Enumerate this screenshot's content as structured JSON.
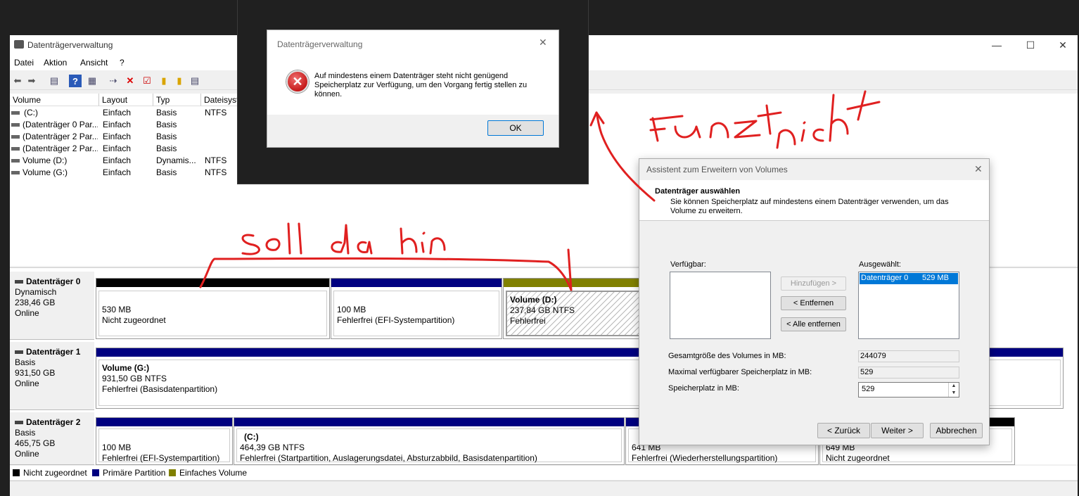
{
  "main_window": {
    "title": "Datenträgerverwaltung",
    "menu": [
      "Datei",
      "Aktion",
      "Ansicht",
      "?"
    ],
    "columns": [
      "Volume",
      "Layout",
      "Typ",
      "Dateisyst"
    ],
    "volumes": [
      {
        "name": "(C:)",
        "layout": "Einfach",
        "typ": "Basis",
        "fs": "NTFS"
      },
      {
        "name": "(Datenträger 0 Par...",
        "layout": "Einfach",
        "typ": "Basis",
        "fs": ""
      },
      {
        "name": "(Datenträger 2 Par...",
        "layout": "Einfach",
        "typ": "Basis",
        "fs": ""
      },
      {
        "name": "(Datenträger 2 Par...",
        "layout": "Einfach",
        "typ": "Basis",
        "fs": ""
      },
      {
        "name": "Volume (D:)",
        "layout": "Einfach",
        "typ": "Dynamis...",
        "fs": "NTFS"
      },
      {
        "name": "Volume (G:)",
        "layout": "Einfach",
        "typ": "Basis",
        "fs": "NTFS"
      }
    ],
    "disks": [
      {
        "name": "Datenträger 0",
        "type": "Dynamisch",
        "size": "238,46 GB",
        "status": "Online",
        "partitions": [
          {
            "title": "",
            "size": "530 MB",
            "status": "Nicht zugeordnet"
          },
          {
            "title": "",
            "size": "100 MB",
            "status": "Fehlerfrei (EFI-Systempartition)"
          },
          {
            "title": "Volume  (D:)",
            "size": "237,84 GB NTFS",
            "status": "Fehlerfrei"
          }
        ]
      },
      {
        "name": "Datenträger 1",
        "type": "Basis",
        "size": "931,50 GB",
        "status": "Online",
        "partitions": [
          {
            "title": "Volume  (G:)",
            "size": "931,50 GB NTFS",
            "status": "Fehlerfrei (Basisdatenpartition)"
          }
        ]
      },
      {
        "name": "Datenträger 2",
        "type": "Basis",
        "size": "465,75 GB",
        "status": "Online",
        "partitions": [
          {
            "title": "",
            "size": "100 MB",
            "status": "Fehlerfrei (EFI-Systempartition)"
          },
          {
            "title": "(C:)",
            "size": "464,39 GB NTFS",
            "status": "Fehlerfrei (Startpartition, Auslagerungsdatei, Absturzabbild, Basisdatenpartition)"
          },
          {
            "title": "",
            "size": "641 MB",
            "status": "Fehlerfrei (Wiederherstellungspartition)"
          },
          {
            "title": "",
            "size": "649 MB",
            "status": "Nicht zugeordnet"
          }
        ]
      }
    ],
    "legend": [
      "Nicht zugeordnet",
      "Primäre Partition",
      "Einfaches Volume"
    ],
    "colors": {
      "unallocated": "#000000",
      "primary": "#000080",
      "simple": "#808000"
    }
  },
  "error_dialog": {
    "title": "Datenträgerverwaltung",
    "message": "Auf mindestens einem Datenträger steht nicht genügend Speicherplatz zur Verfügung, um den Vorgang fertig stellen zu können.",
    "ok": "OK"
  },
  "wizard": {
    "title": "Assistent zum Erweitern von Volumes",
    "heading": "Datenträger auswählen",
    "subheading": "Sie können Speicherplatz auf mindestens einem Datenträger verwenden, um das Volume zu erweitern.",
    "available_label": "Verfügbar:",
    "selected_label": "Ausgewählt:",
    "selected_item": {
      "name": "Datenträger 0",
      "size": "529 MB"
    },
    "add": "Hinzufügen >",
    "remove": "< Entfernen",
    "remove_all": "< Alle entfernen",
    "total_label": "Gesamtgröße des Volumes in MB:",
    "total_value": "244079",
    "max_label": "Maximal verfügbarer Speicherplatz in MB:",
    "max_value": "529",
    "space_label": "Speicherplatz in MB:",
    "space_value": "529",
    "back": "< Zurück",
    "next": "Weiter >",
    "cancel": "Abbrechen"
  },
  "annotations": [
    "Funzt nicht",
    "soll da hin"
  ]
}
